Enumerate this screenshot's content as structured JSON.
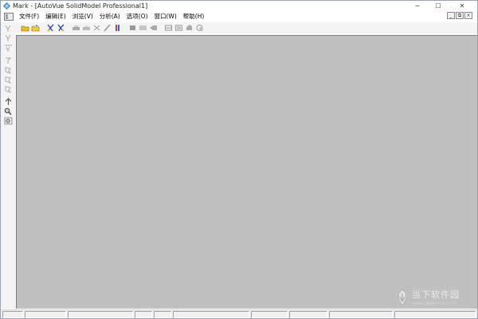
{
  "window": {
    "title": "Mark - [AutoVue SolidModel Professional1]"
  },
  "caption": {
    "minimize": "─",
    "maximize": "☐",
    "close": "✕"
  },
  "menubar": {
    "items": [
      "文件(F)",
      "编辑(E)",
      "浏览(V)",
      "分析(A)",
      "选项(O)",
      "窗口(W)",
      "帮助(H)"
    ],
    "mdi_minimize": "_",
    "mdi_restore": "⧉",
    "mdi_close": "×"
  },
  "toolbar": {
    "icons": [
      "open-folder-icon",
      "open-file-icon",
      "markup-icon",
      "markup-entity-icon",
      "print-icon",
      "print-preview-icon",
      "fit-icon",
      "pen-icon",
      "measure-icon",
      "box-icon",
      "layers-icon",
      "shade-icon",
      "view-front-icon",
      "view-top-icon",
      "view-side-icon",
      "rotate-icon"
    ]
  },
  "left_toolbar": {
    "icons": [
      "select-icon",
      "select-entity-icon",
      "text-icon",
      "transform-icon",
      "pan-icon",
      "zoom-in-icon",
      "zoom-out-icon",
      "up-arrow-icon",
      "zoom-window-icon",
      "zoom-fit-icon"
    ]
  },
  "watermark": {
    "name": "当下软件园",
    "url": "www.downxia.com"
  },
  "colors": {
    "canvas": "#c0c0c0",
    "toolbar": "#f4f4f4",
    "icon_yellow": "#e8c020",
    "icon_blue": "#2040c0"
  }
}
